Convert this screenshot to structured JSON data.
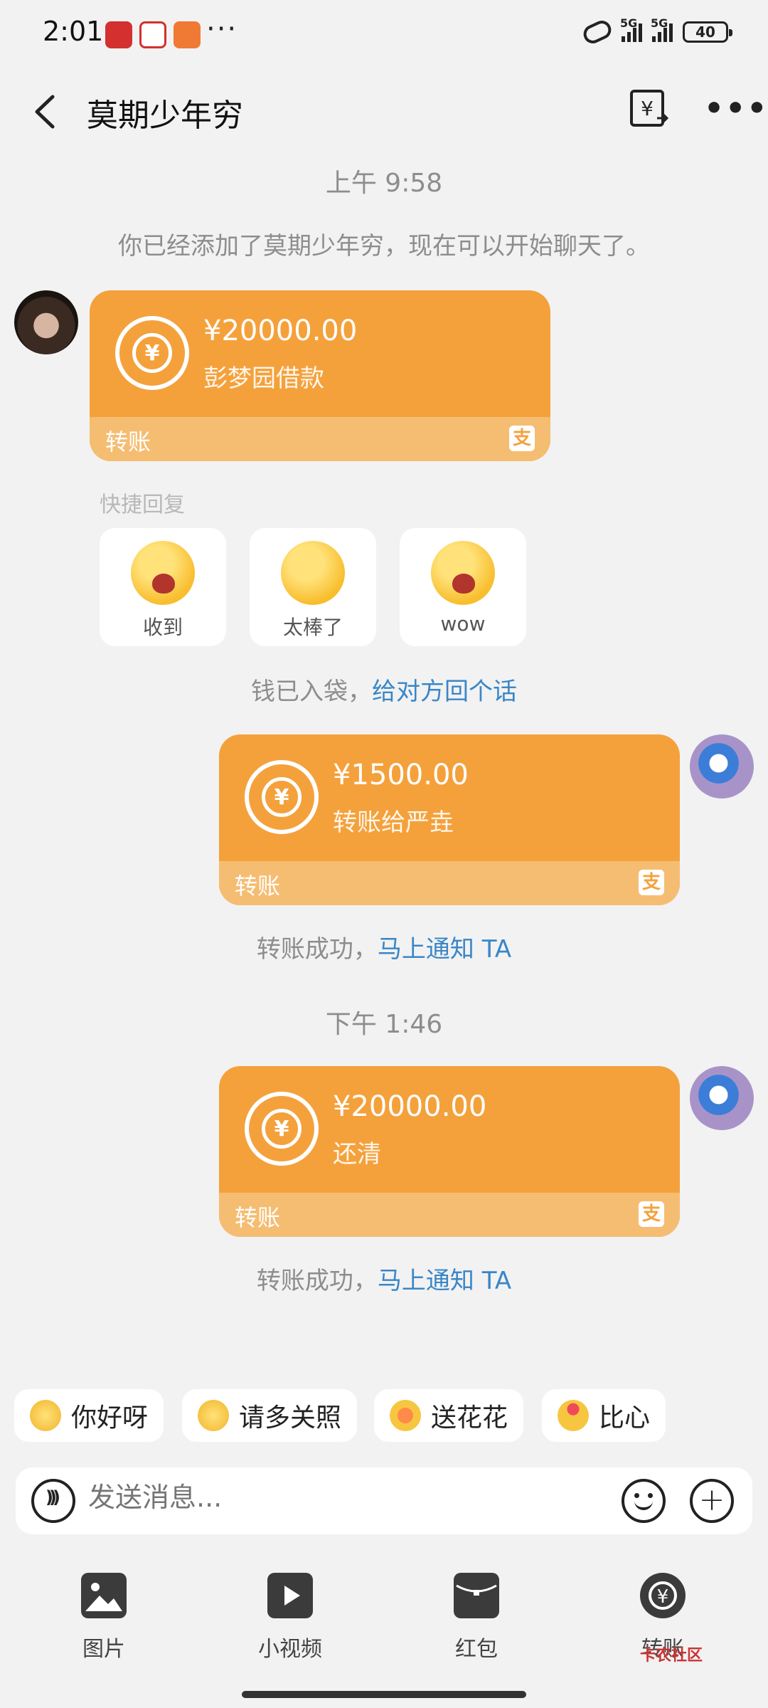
{
  "status_bar": {
    "time": "2:01",
    "dots": "···",
    "network1": "5G",
    "network2": "5G",
    "battery": "40"
  },
  "header": {
    "title": "莫期少年穷"
  },
  "messages": {
    "time1": "上午 9:58",
    "system_note": "你已经添加了莫期少年穷，现在可以开始聊天了。",
    "card1": {
      "amount": "¥20000.00",
      "note": "彭梦园借款",
      "footer": "转账"
    },
    "quick_reply_title": "快捷回复",
    "quick_replies": [
      "收到",
      "太棒了",
      "wow"
    ],
    "receipt1": {
      "text": "钱已入袋，",
      "link": "给对方回个话"
    },
    "card2": {
      "amount": "¥1500.00",
      "note": "转账给严垚",
      "footer": "转账"
    },
    "receipt2": {
      "text": "转账成功，",
      "link": "马上通知 TA"
    },
    "time2": "下午 1:46",
    "card3": {
      "amount": "¥20000.00",
      "note": "还清",
      "footer": "转账"
    },
    "receipt3": {
      "text": "转账成功，",
      "link": "马上通知 TA"
    }
  },
  "chips": [
    "你好呀",
    "请多关照",
    "送花花",
    "比心"
  ],
  "input": {
    "placeholder": "发送消息..."
  },
  "toolbar": {
    "items": [
      "图片",
      "小视频",
      "红包",
      "转账"
    ]
  },
  "watermark": "卡农社区",
  "colors": {
    "card": "#f4a13c",
    "card_footer": "#f5bd72",
    "link": "#3a86c8",
    "background": "#f2f2f2"
  }
}
